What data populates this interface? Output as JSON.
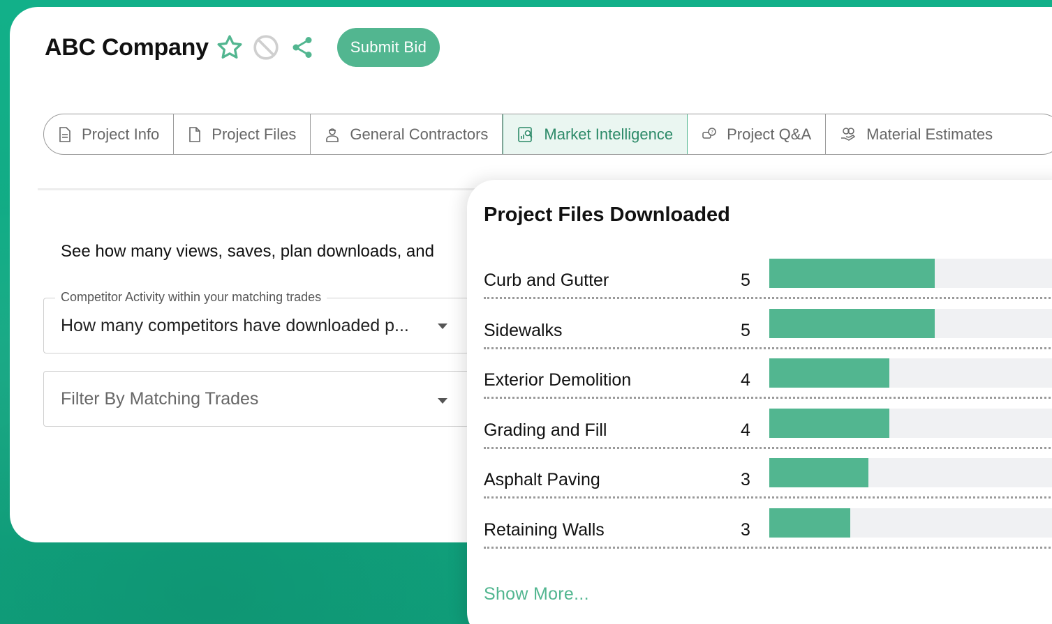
{
  "header": {
    "company_name": "ABC Company",
    "submit_label": "Submit Bid",
    "accent_color": "#52b690"
  },
  "tabs": [
    {
      "label": "Project Info",
      "icon": "document-icon",
      "active": false
    },
    {
      "label": "Project Files",
      "icon": "file-icon",
      "active": false
    },
    {
      "label": "General Contractors",
      "icon": "worker-icon",
      "active": false
    },
    {
      "label": "Market Intelligence",
      "icon": "chart-search-icon",
      "active": true
    },
    {
      "label": "Project Q&A",
      "icon": "chat-question-icon",
      "active": false
    },
    {
      "label": "Material Estimates",
      "icon": "money-hand-icon",
      "active": false
    }
  ],
  "main": {
    "description": "See how many views, saves, plan downloads, and",
    "competitor_field": {
      "legend": "Competitor Activity within your matching trades",
      "value": "How many competitors have downloaded p..."
    },
    "trade_filter": {
      "placeholder": "Filter By Matching Trades"
    }
  },
  "chart": {
    "title": "Project Files Downloaded",
    "show_more": "Show More..."
  },
  "chart_data": {
    "type": "bar",
    "orientation": "horizontal",
    "title": "Project Files Downloaded",
    "categories": [
      "Curb and Gutter",
      "Sidewalks",
      "Exterior Demolition",
      "Grading and Fill",
      "Asphalt Paving",
      "Retaining Walls"
    ],
    "values": [
      5,
      5,
      4,
      4,
      3,
      3
    ],
    "value_labels": [
      "5",
      "5",
      "4",
      "4",
      "3",
      "3"
    ],
    "bar_fill_fraction": [
      0.55,
      0.55,
      0.4,
      0.4,
      0.33,
      0.27
    ],
    "bar_color": "#52b690",
    "track_color": "#f0f1f3"
  }
}
